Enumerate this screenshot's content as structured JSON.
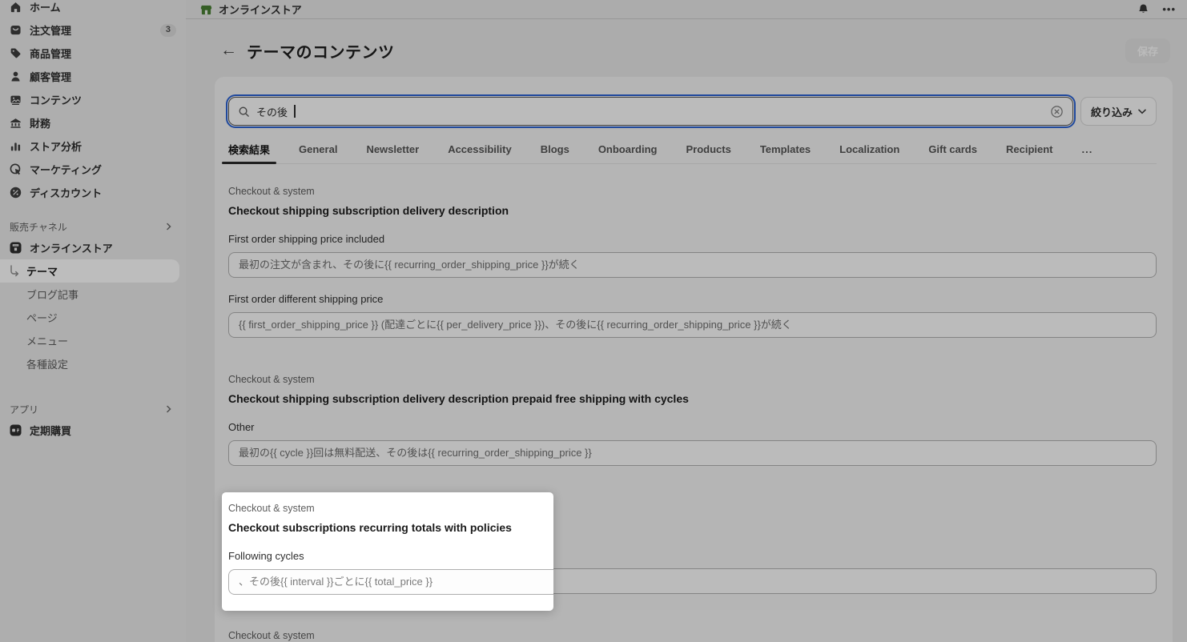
{
  "topbar": {
    "store_name": "オンラインストア"
  },
  "page": {
    "title": "テーマのコンテンツ",
    "save_label": "保存"
  },
  "search": {
    "value": "その後",
    "filter_label": "絞り込み"
  },
  "tabs": {
    "items": [
      {
        "label": "検索結果",
        "selected": true
      },
      {
        "label": "General"
      },
      {
        "label": "Newsletter"
      },
      {
        "label": "Accessibility"
      },
      {
        "label": "Blogs"
      },
      {
        "label": "Onboarding"
      },
      {
        "label": "Products"
      },
      {
        "label": "Templates"
      },
      {
        "label": "Localization"
      },
      {
        "label": "Gift cards"
      },
      {
        "label": "Recipient"
      }
    ],
    "overflow_label": "..."
  },
  "sidebar": {
    "items": [
      {
        "label": "ホーム"
      },
      {
        "label": "注文管理",
        "badge": "3"
      },
      {
        "label": "商品管理"
      },
      {
        "label": "顧客管理"
      },
      {
        "label": "コンテンツ"
      },
      {
        "label": "財務"
      },
      {
        "label": "ストア分析"
      },
      {
        "label": "マーケティング"
      },
      {
        "label": "ディスカウント"
      }
    ],
    "sales_channels_header": "販売チャネル",
    "online_store": "オンラインストア",
    "online_store_children": [
      {
        "label": "テーマ",
        "selected": true
      },
      {
        "label": "ブログ記事"
      },
      {
        "label": "ページ"
      },
      {
        "label": "メニュー"
      },
      {
        "label": "各種設定"
      }
    ],
    "apps_header": "アプリ",
    "app_item": "定期購買"
  },
  "sections": [
    {
      "category": "Checkout & system",
      "title": "Checkout shipping subscription delivery description",
      "fields": [
        {
          "label": "First order shipping price included",
          "value": "最初の注文が含まれ、その後に{{ recurring_order_shipping_price }}が続く"
        },
        {
          "label": "First order different shipping price",
          "value": "{{ first_order_shipping_price }} (配達ごとに{{ per_delivery_price }})、その後に{{ recurring_order_shipping_price }}が続く"
        }
      ]
    },
    {
      "category": "Checkout & system",
      "title": "Checkout shipping subscription delivery description prepaid free shipping with cycles",
      "fields": [
        {
          "label": "Other",
          "value": "最初の{{ cycle }}回は無料配送、その後は{{ recurring_order_shipping_price }}"
        }
      ]
    },
    {
      "category": "Checkout & system",
      "title": "Checkout subscriptions recurring totals with policies",
      "highlighted": true,
      "fields": [
        {
          "label": "Following cycles",
          "value": "、その後{{ interval }}ごとに{{ total_price }}"
        }
      ]
    },
    {
      "category": "Checkout & system"
    }
  ],
  "colors": {
    "focus_ring": "#2c63d4",
    "store_icon_green": "#4a8134",
    "spotlight_bg": "#ffffff",
    "selected_tab_underline": "#2b2b2b"
  }
}
